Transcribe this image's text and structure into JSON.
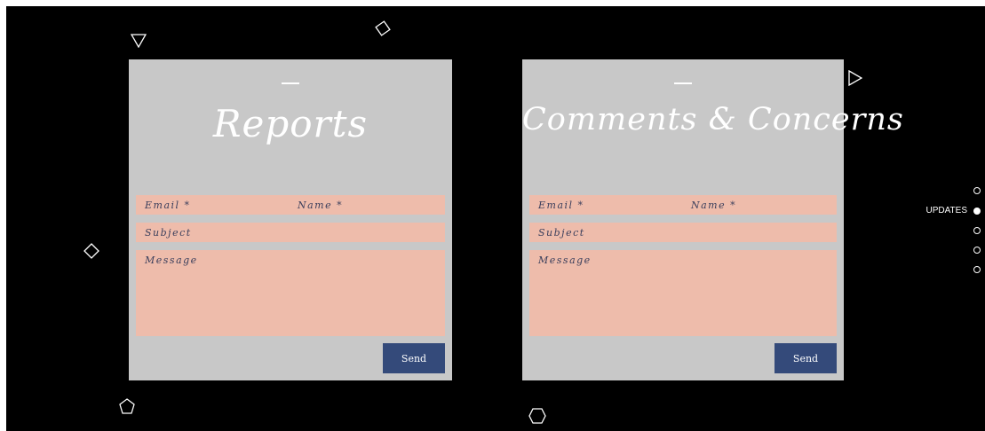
{
  "forms": [
    {
      "title": "Reports",
      "email_placeholder": "Email *",
      "name_placeholder": "Name *",
      "subject_placeholder": "Subject",
      "message_placeholder": "Message",
      "send_label": "Send"
    },
    {
      "title": "Comments & Concerns",
      "email_placeholder": "Email *",
      "name_placeholder": "Name *",
      "subject_placeholder": "Subject",
      "message_placeholder": "Message",
      "send_label": "Send"
    }
  ],
  "side_nav": {
    "active_label": "UPDATES",
    "item_count": 5,
    "active_index": 1
  },
  "colors": {
    "background": "#000000",
    "card": "#c8c8c8",
    "field": "#eebcab",
    "button": "#344a7a",
    "accent_text": "#ffffff"
  }
}
